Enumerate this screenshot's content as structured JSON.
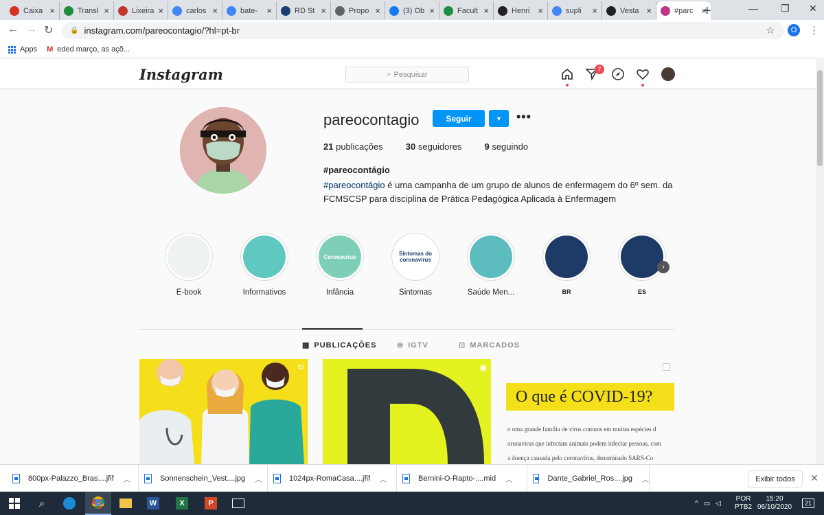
{
  "browser": {
    "tabs": [
      {
        "label": "Caixa",
        "icon": "gmail-icon",
        "color": "#d93025"
      },
      {
        "label": "Transl",
        "icon": "green-circle-icon",
        "color": "#1e8e3e"
      },
      {
        "label": "Lixeira",
        "icon": "tongue-icon",
        "color": "#c0392b"
      },
      {
        "label": "carlos",
        "icon": "google-icon",
        "color": "#4285f4"
      },
      {
        "label": "bate-",
        "icon": "google-icon",
        "color": "#4285f4"
      },
      {
        "label": "RD St",
        "icon": "rd-icon",
        "color": "#1a3d6e"
      },
      {
        "label": "Propo",
        "icon": "globe-icon",
        "color": "#5f6368"
      },
      {
        "label": "(3) Ob",
        "icon": "facebook-icon",
        "color": "#1877f2"
      },
      {
        "label": "Facult",
        "icon": "green-circle-icon",
        "color": "#1e8e3e"
      },
      {
        "label": "Henri",
        "icon": "wikipedia-icon",
        "color": "#202124"
      },
      {
        "label": "supli",
        "icon": "google-icon",
        "color": "#4285f4"
      },
      {
        "label": "Vesta",
        "icon": "wikipedia-icon",
        "color": "#202124"
      },
      {
        "label": "#parc",
        "icon": "instagram-icon",
        "color": "#c13584"
      }
    ],
    "url": "instagram.com/pareocontagio/?hl=pt-br",
    "profile_initial": "O",
    "bookmarks": {
      "apps": "Apps",
      "item": "eded março, as açõ..."
    }
  },
  "ig": {
    "logo": "Instagram",
    "search_placeholder": "Pesquisar",
    "activity_count": "7",
    "username": "pareocontagio",
    "follow_label": "Seguir",
    "stats": {
      "posts_num": "21",
      "posts_label": "publicações",
      "followers_num": "30",
      "followers_label": "seguidores",
      "following_num": "9",
      "following_label": "seguindo"
    },
    "bio_name": "#pareocontágio",
    "bio_tag": "#pareocontágio",
    "bio_text": " é uma campanha de um grupo de alunos de enfermagem do 6º sem. da FCMSCSP para disciplina de Prática Pedagógica Aplicada à Enfermagem",
    "highlights": [
      {
        "label": "E-book",
        "bg": "#eef3ef",
        "cover": ""
      },
      {
        "label": "Informativos",
        "bg": "#5fc8c0",
        "cover": ""
      },
      {
        "label": "Infância",
        "bg": "#7fcfb8",
        "cover": "Coronavirus"
      },
      {
        "label": "Sintomas",
        "bg": "#ffffff",
        "cover": "Sintomas do coronavírus"
      },
      {
        "label": "Saúde Men...",
        "bg": "#5dbcbe",
        "cover": ""
      },
      {
        "label": "BR",
        "bg": "#1e3a66",
        "cover": ""
      },
      {
        "label": "ES",
        "bg": "#1e3a66",
        "cover": ""
      }
    ],
    "post_tabs": [
      {
        "label": "PUBLICAÇÕES",
        "icon": "grid-icon"
      },
      {
        "label": "IGTV",
        "icon": "igtv-icon"
      },
      {
        "label": "MARCADOS",
        "icon": "tagged-icon"
      }
    ],
    "post3": {
      "title": "O que é COVID-19?",
      "lines": [
        "o uma grande família de vírus comuns em muitas espécies d",
        "oronavírus que infectam animais podem infectar pessoas, com",
        "a doença causada pelo coronavírus, denominado SARS-Co"
      ]
    }
  },
  "downloads": {
    "items": [
      {
        "name": "800px-Palazzo_Bras....jfif"
      },
      {
        "name": "Sonnenschein_Vest....jpg"
      },
      {
        "name": "1024px-RomaCasa....jfif"
      },
      {
        "name": "Bernini-O-Rapto-....mid"
      },
      {
        "name": "Dante_Gabriel_Ros....jpg"
      }
    ],
    "show_all": "Exibir todos"
  },
  "taskbar": {
    "lang": "POR",
    "layout": "PTB2",
    "time": "15:20",
    "date": "06/10/2020",
    "notifications": "21"
  }
}
